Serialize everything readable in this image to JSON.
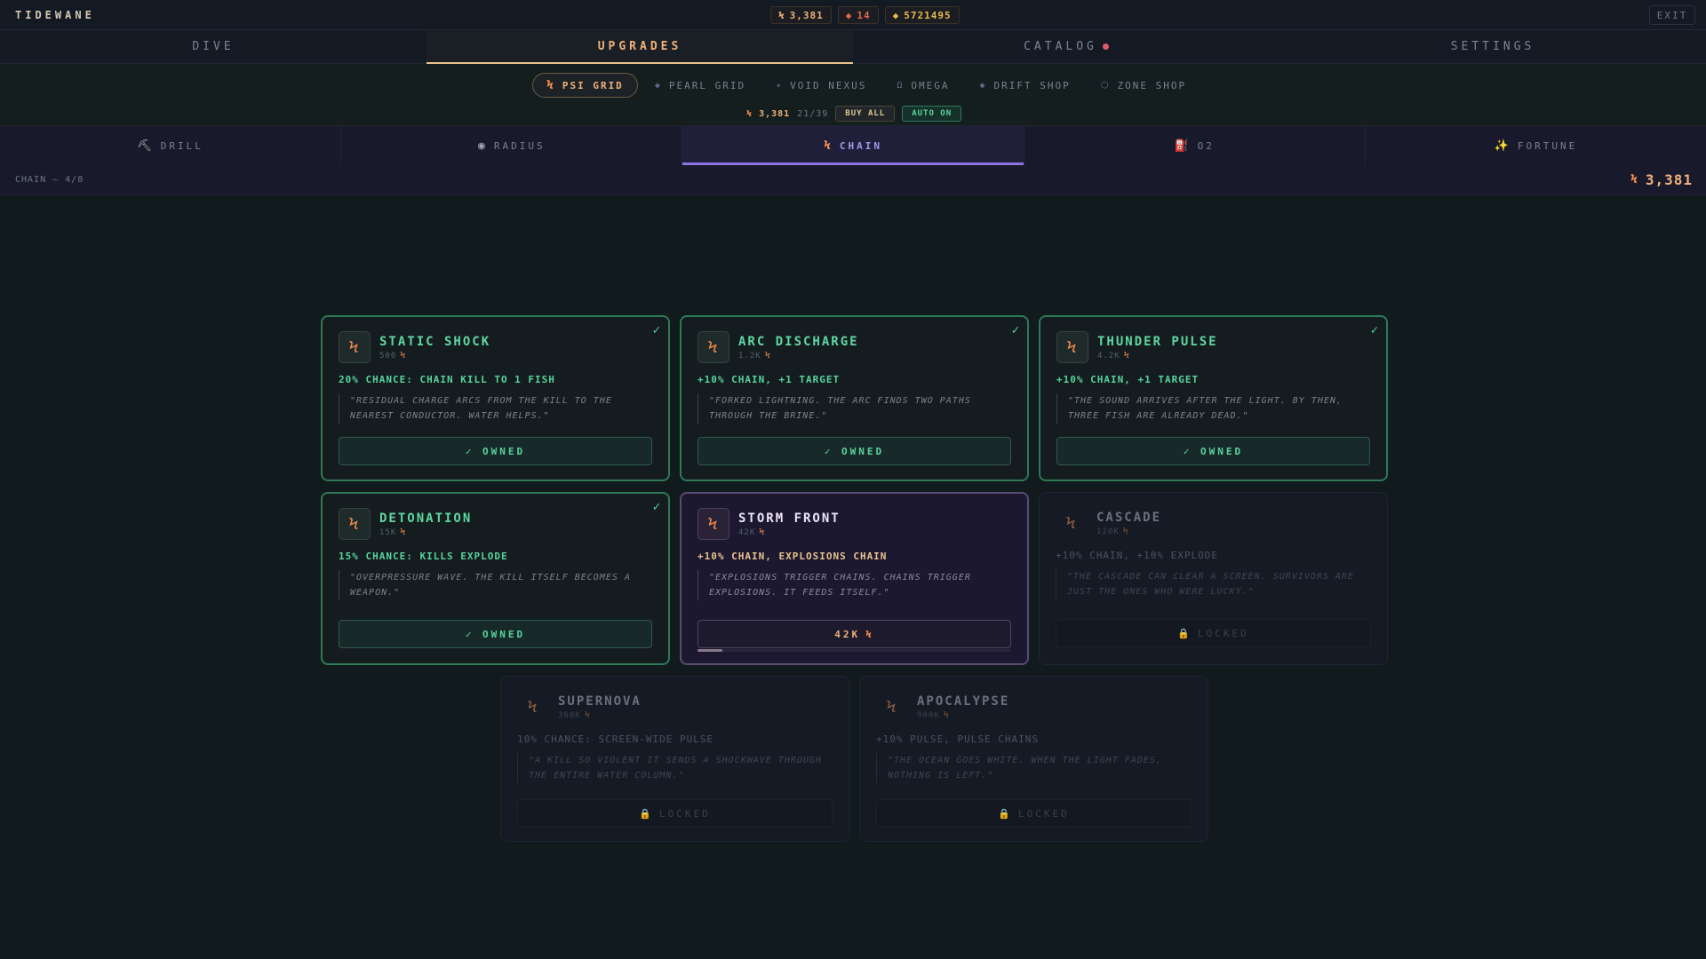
{
  "app": {
    "brand": "TIDEWANE",
    "exit_label": "EXIT"
  },
  "resources": {
    "psi": "3,381",
    "pearls": "14",
    "gold": "5721495"
  },
  "main_nav": {
    "tabs": [
      {
        "label": "DIVE"
      },
      {
        "label": "UPGRADES"
      },
      {
        "label": "CATALOG"
      },
      {
        "label": "SETTINGS"
      }
    ],
    "active": "UPGRADES"
  },
  "sub_nav": {
    "tabs": [
      {
        "label": "PSI GRID",
        "icon": "bolt-icon"
      },
      {
        "label": "PEARL GRID",
        "icon": "diamond-icon"
      },
      {
        "label": "VOID NEXUS",
        "icon": "sparkle-icon"
      },
      {
        "label": "OMEGA",
        "icon": "omega-icon"
      },
      {
        "label": "DRIFT SHOP",
        "icon": "diamond-icon"
      },
      {
        "label": "ZONE SHOP",
        "icon": "hexagon-icon"
      }
    ],
    "active": "PSI GRID",
    "balance": "3,381",
    "owned_count": "21/39",
    "buy_all_label": "BUY ALL",
    "auto_label": "AUTO ON"
  },
  "categories": {
    "tabs": [
      {
        "label": "DRILL",
        "icon": "pickaxe-icon"
      },
      {
        "label": "RADIUS",
        "icon": "target-icon"
      },
      {
        "label": "CHAIN",
        "icon": "bolt-icon"
      },
      {
        "label": "O2",
        "icon": "tank-icon"
      },
      {
        "label": "FORTUNE",
        "icon": "sparkle-icon"
      }
    ],
    "active": "CHAIN"
  },
  "progress": {
    "label": "CHAIN — 4/8",
    "balance": "3,381"
  },
  "cards": [
    {
      "title": "STATIC SHOCK",
      "cost": "500",
      "effect": "20% CHANCE: CHAIN KILL TO 1 FISH",
      "quote": "\"RESIDUAL CHARGE ARCS FROM THE KILL TO THE NEAREST CONDUCTOR. WATER HELPS.\"",
      "state": "owned",
      "button": "✓ OWNED"
    },
    {
      "title": "ARC DISCHARGE",
      "cost": "1.2K",
      "effect": "+10% CHAIN, +1 TARGET",
      "quote": "\"FORKED LIGHTNING. THE ARC FINDS TWO PATHS THROUGH THE BRINE.\"",
      "state": "owned",
      "button": "✓ OWNED"
    },
    {
      "title": "THUNDER PULSE",
      "cost": "4.2K",
      "effect": "+10% CHAIN, +1 TARGET",
      "quote": "\"THE SOUND ARRIVES AFTER THE LIGHT. BY THEN, THREE FISH ARE ALREADY DEAD.\"",
      "state": "owned",
      "button": "✓ OWNED"
    },
    {
      "title": "DETONATION",
      "cost": "15K",
      "effect": "15% CHANCE: KILLS EXPLODE",
      "quote": "\"OVERPRESSURE WAVE. THE KILL ITSELF BECOMES A WEAPON.\"",
      "state": "owned",
      "button": "✓ OWNED"
    },
    {
      "title": "STORM FRONT",
      "cost": "42K",
      "effect": "+10% CHAIN, EXPLOSIONS CHAIN",
      "quote": "\"EXPLOSIONS TRIGGER CHAINS. CHAINS TRIGGER EXPLOSIONS. IT FEEDS ITSELF.\"",
      "state": "available",
      "button": "42K",
      "progress": 0.08
    },
    {
      "title": "CASCADE",
      "cost": "120K",
      "effect": "+10% CHAIN, +10% EXPLODE",
      "quote": "\"THE CASCADE CAN CLEAR A SCREEN. SURVIVORS ARE JUST THE ONES WHO WERE LUCKY.\"",
      "state": "locked",
      "button": "LOCKED"
    },
    {
      "title": "SUPERNOVA",
      "cost": "360K",
      "effect": "10% CHANCE: SCREEN-WIDE PULSE",
      "quote": "\"A KILL SO VIOLENT IT SENDS A SHOCKWAVE THROUGH THE ENTIRE WATER COLUMN.\"",
      "state": "locked",
      "button": "LOCKED"
    },
    {
      "title": "APOCALYPSE",
      "cost": "900K",
      "effect": "+10% PULSE, PULSE CHAINS",
      "quote": "\"THE OCEAN GOES WHITE. WHEN THE LIGHT FADES, NOTHING IS LEFT.\"",
      "state": "locked",
      "button": "LOCKED"
    }
  ],
  "colors": {
    "owned": "#58d49b",
    "accent": "#f0b27a",
    "chain_active": "#8c73e0",
    "bolt": "#f08a4a"
  }
}
